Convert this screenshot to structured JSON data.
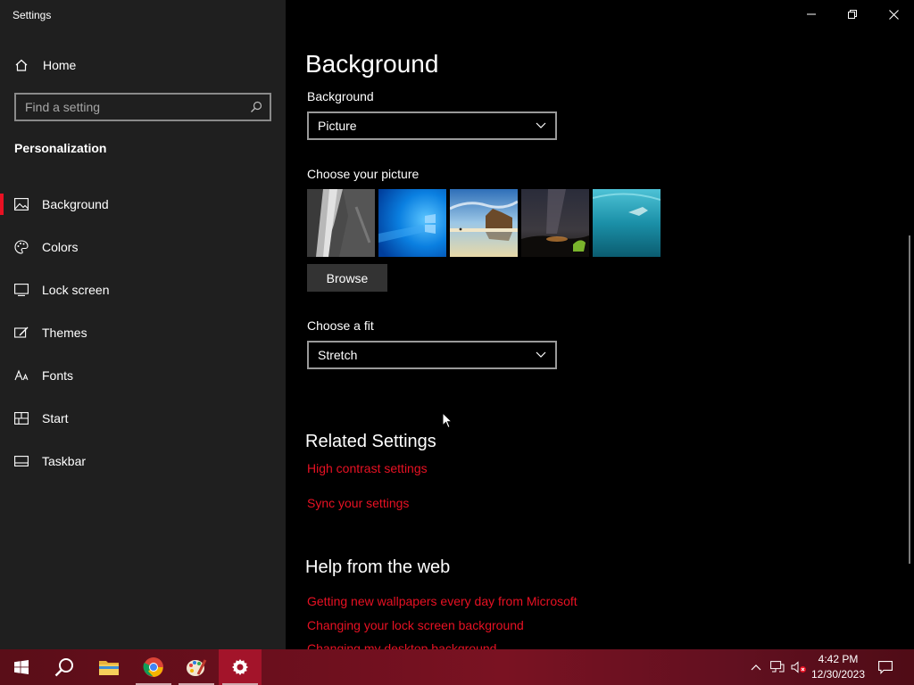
{
  "window": {
    "title": "Settings"
  },
  "sidebar": {
    "home_label": "Home",
    "search_placeholder": "Find a setting",
    "section": "Personalization",
    "items": [
      {
        "label": "Background",
        "icon": "picture-icon",
        "active": true
      },
      {
        "label": "Colors",
        "icon": "palette-icon"
      },
      {
        "label": "Lock screen",
        "icon": "lock-screen-icon"
      },
      {
        "label": "Themes",
        "icon": "themes-icon"
      },
      {
        "label": "Fonts",
        "icon": "fonts-icon"
      },
      {
        "label": "Start",
        "icon": "start-icon"
      },
      {
        "label": "Taskbar",
        "icon": "taskbar-icon"
      }
    ]
  },
  "main": {
    "title": "Background",
    "background_label": "Background",
    "background_value": "Picture",
    "choose_picture_label": "Choose your picture",
    "browse_label": "Browse",
    "fit_label": "Choose a fit",
    "fit_value": "Stretch",
    "related_title": "Related Settings",
    "related_links": [
      "High contrast settings",
      "Sync your settings"
    ],
    "help_title": "Help from the web",
    "help_links": [
      "Getting new wallpapers every day from Microsoft",
      "Changing your lock screen background",
      "Changing my desktop background"
    ]
  },
  "taskbar": {
    "time": "4:42 PM",
    "date": "12/30/2023",
    "apps": [
      "start-icon",
      "search-icon",
      "file-explorer-icon",
      "chrome-icon",
      "paint-icon",
      "settings-gear-icon"
    ]
  },
  "colors": {
    "accent": "#e81123",
    "sidebar": "#1f1f1f",
    "main": "#000000"
  }
}
